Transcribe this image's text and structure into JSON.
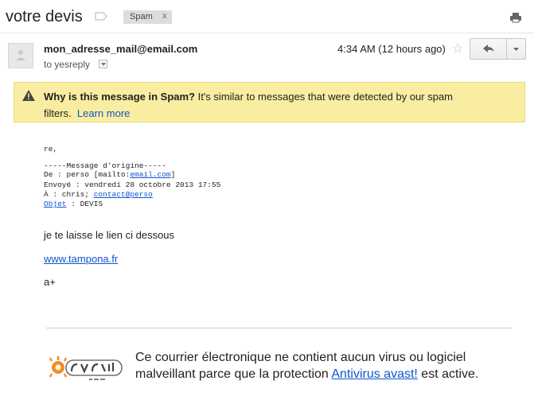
{
  "header": {
    "subject": "votre devis",
    "label_chip": "Spam",
    "label_chip_close": "x"
  },
  "message": {
    "sender": "mon_adresse_mail@email.com",
    "recipient": "to yesreply",
    "time": "4:34 AM (12 hours ago)",
    "star_glyph": "☆"
  },
  "spam_banner": {
    "title": "Why is this message in Spam?",
    "text_line1": " It's similar to messages that were detected by our spam",
    "text_line2": "filters.",
    "learn_more": "Learn more"
  },
  "body": {
    "greeting": "re,",
    "original_header": "-----Message d'origine-----",
    "de_prefix": "De : perso [mailto:",
    "de_link": "email.com",
    "de_suffix": "]",
    "envoye": "Envoyé : vendredi 28 octobre 2013 17:55",
    "a_prefix": "À : chris; ",
    "a_link": "contact@perso",
    "objet_link": "Objet",
    "objet_suffix": " : DEVIS",
    "line1": "je te laisse le lien ci dessous",
    "link": "www.tampona.fr",
    "signoff": "a+"
  },
  "footer": {
    "text_before": "Ce courrier électronique ne contient aucun virus ou logiciel malveillant parce que la protection ",
    "link": "Antivirus avast!",
    "text_after": " est active."
  },
  "colors": {
    "banner_bg": "#f9eda1",
    "link": "#1155cc",
    "avast_orange": "#f68b1f"
  }
}
